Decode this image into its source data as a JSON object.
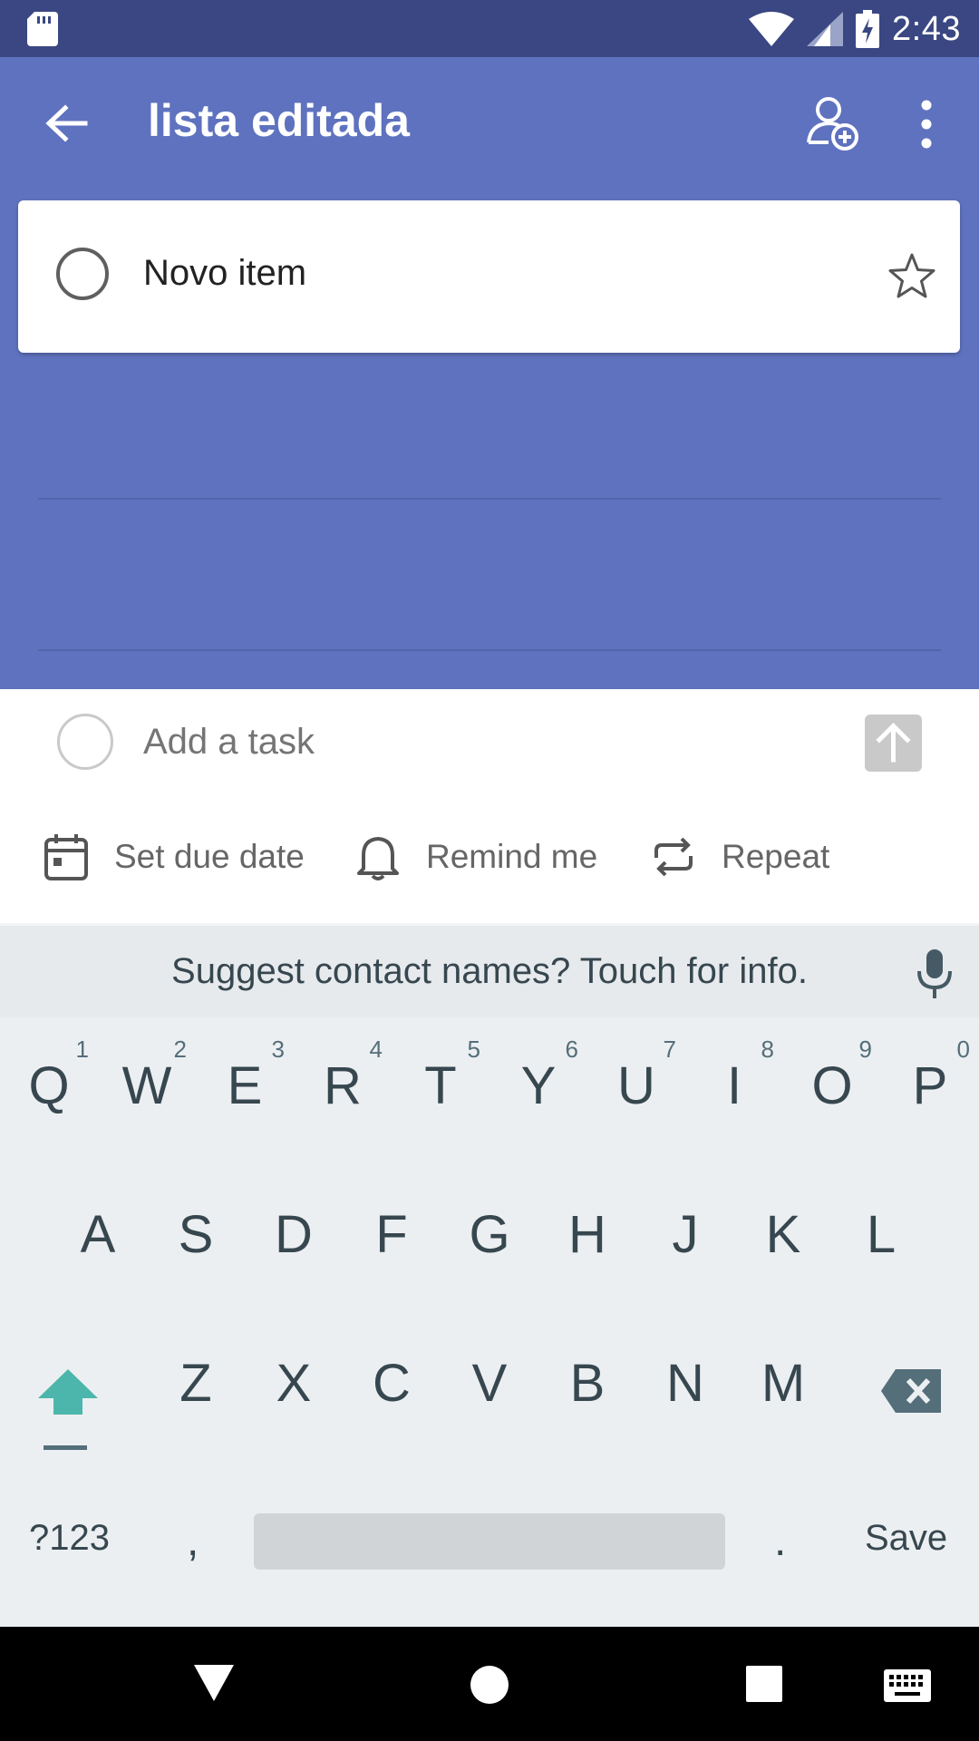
{
  "status_bar": {
    "time": "2:43"
  },
  "app_bar": {
    "title": "lista editada"
  },
  "tasks": [
    {
      "title": "Novo item"
    }
  ],
  "composer": {
    "placeholder": "Add a task",
    "options": [
      {
        "label": "Set due date",
        "icon": "calendar-icon"
      },
      {
        "label": "Remind me",
        "icon": "bell-icon"
      },
      {
        "label": "Repeat",
        "icon": "repeat-icon"
      }
    ]
  },
  "keyboard": {
    "suggestion": "Suggest contact names? Touch for info.",
    "row1": [
      "Q",
      "W",
      "E",
      "R",
      "T",
      "Y",
      "U",
      "I",
      "O",
      "P"
    ],
    "row1_hints": [
      "1",
      "2",
      "3",
      "4",
      "5",
      "6",
      "7",
      "8",
      "9",
      "0"
    ],
    "row2": [
      "A",
      "S",
      "D",
      "F",
      "G",
      "H",
      "J",
      "K",
      "L"
    ],
    "row3": [
      "Z",
      "X",
      "C",
      "V",
      "B",
      "N",
      "M"
    ],
    "symbols_key": "?123",
    "comma_key": ",",
    "period_key": ".",
    "action_key": "Save"
  },
  "colors": {
    "accent": "#5f72bf",
    "status_bar": "#3a4782",
    "shift": "#4db6ac"
  }
}
